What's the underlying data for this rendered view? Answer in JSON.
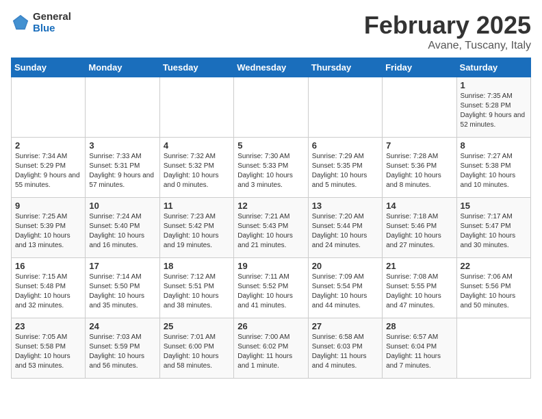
{
  "header": {
    "logo_general": "General",
    "logo_blue": "Blue",
    "title": "February 2025",
    "subtitle": "Avane, Tuscany, Italy"
  },
  "weekdays": [
    "Sunday",
    "Monday",
    "Tuesday",
    "Wednesday",
    "Thursday",
    "Friday",
    "Saturday"
  ],
  "weeks": [
    [
      {
        "day": "",
        "info": ""
      },
      {
        "day": "",
        "info": ""
      },
      {
        "day": "",
        "info": ""
      },
      {
        "day": "",
        "info": ""
      },
      {
        "day": "",
        "info": ""
      },
      {
        "day": "",
        "info": ""
      },
      {
        "day": "1",
        "info": "Sunrise: 7:35 AM\nSunset: 5:28 PM\nDaylight: 9 hours and 52 minutes."
      }
    ],
    [
      {
        "day": "2",
        "info": "Sunrise: 7:34 AM\nSunset: 5:29 PM\nDaylight: 9 hours and 55 minutes."
      },
      {
        "day": "3",
        "info": "Sunrise: 7:33 AM\nSunset: 5:31 PM\nDaylight: 9 hours and 57 minutes."
      },
      {
        "day": "4",
        "info": "Sunrise: 7:32 AM\nSunset: 5:32 PM\nDaylight: 10 hours and 0 minutes."
      },
      {
        "day": "5",
        "info": "Sunrise: 7:30 AM\nSunset: 5:33 PM\nDaylight: 10 hours and 3 minutes."
      },
      {
        "day": "6",
        "info": "Sunrise: 7:29 AM\nSunset: 5:35 PM\nDaylight: 10 hours and 5 minutes."
      },
      {
        "day": "7",
        "info": "Sunrise: 7:28 AM\nSunset: 5:36 PM\nDaylight: 10 hours and 8 minutes."
      },
      {
        "day": "8",
        "info": "Sunrise: 7:27 AM\nSunset: 5:38 PM\nDaylight: 10 hours and 10 minutes."
      }
    ],
    [
      {
        "day": "9",
        "info": "Sunrise: 7:25 AM\nSunset: 5:39 PM\nDaylight: 10 hours and 13 minutes."
      },
      {
        "day": "10",
        "info": "Sunrise: 7:24 AM\nSunset: 5:40 PM\nDaylight: 10 hours and 16 minutes."
      },
      {
        "day": "11",
        "info": "Sunrise: 7:23 AM\nSunset: 5:42 PM\nDaylight: 10 hours and 19 minutes."
      },
      {
        "day": "12",
        "info": "Sunrise: 7:21 AM\nSunset: 5:43 PM\nDaylight: 10 hours and 21 minutes."
      },
      {
        "day": "13",
        "info": "Sunrise: 7:20 AM\nSunset: 5:44 PM\nDaylight: 10 hours and 24 minutes."
      },
      {
        "day": "14",
        "info": "Sunrise: 7:18 AM\nSunset: 5:46 PM\nDaylight: 10 hours and 27 minutes."
      },
      {
        "day": "15",
        "info": "Sunrise: 7:17 AM\nSunset: 5:47 PM\nDaylight: 10 hours and 30 minutes."
      }
    ],
    [
      {
        "day": "16",
        "info": "Sunrise: 7:15 AM\nSunset: 5:48 PM\nDaylight: 10 hours and 32 minutes."
      },
      {
        "day": "17",
        "info": "Sunrise: 7:14 AM\nSunset: 5:50 PM\nDaylight: 10 hours and 35 minutes."
      },
      {
        "day": "18",
        "info": "Sunrise: 7:12 AM\nSunset: 5:51 PM\nDaylight: 10 hours and 38 minutes."
      },
      {
        "day": "19",
        "info": "Sunrise: 7:11 AM\nSunset: 5:52 PM\nDaylight: 10 hours and 41 minutes."
      },
      {
        "day": "20",
        "info": "Sunrise: 7:09 AM\nSunset: 5:54 PM\nDaylight: 10 hours and 44 minutes."
      },
      {
        "day": "21",
        "info": "Sunrise: 7:08 AM\nSunset: 5:55 PM\nDaylight: 10 hours and 47 minutes."
      },
      {
        "day": "22",
        "info": "Sunrise: 7:06 AM\nSunset: 5:56 PM\nDaylight: 10 hours and 50 minutes."
      }
    ],
    [
      {
        "day": "23",
        "info": "Sunrise: 7:05 AM\nSunset: 5:58 PM\nDaylight: 10 hours and 53 minutes."
      },
      {
        "day": "24",
        "info": "Sunrise: 7:03 AM\nSunset: 5:59 PM\nDaylight: 10 hours and 56 minutes."
      },
      {
        "day": "25",
        "info": "Sunrise: 7:01 AM\nSunset: 6:00 PM\nDaylight: 10 hours and 58 minutes."
      },
      {
        "day": "26",
        "info": "Sunrise: 7:00 AM\nSunset: 6:02 PM\nDaylight: 11 hours and 1 minute."
      },
      {
        "day": "27",
        "info": "Sunrise: 6:58 AM\nSunset: 6:03 PM\nDaylight: 11 hours and 4 minutes."
      },
      {
        "day": "28",
        "info": "Sunrise: 6:57 AM\nSunset: 6:04 PM\nDaylight: 11 hours and 7 minutes."
      },
      {
        "day": "",
        "info": ""
      }
    ]
  ]
}
